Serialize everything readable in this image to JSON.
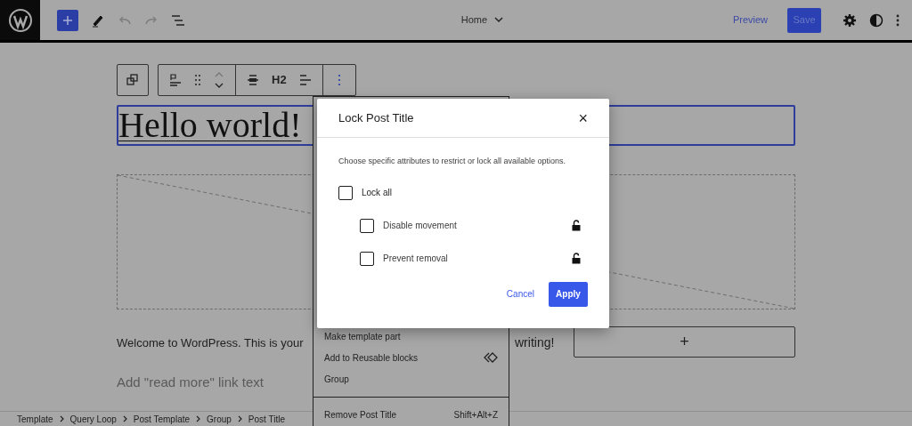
{
  "top_bar": {
    "document_title": "Home",
    "preview": "Preview",
    "save": "Save"
  },
  "block_toolbar": {
    "heading_level": "H2"
  },
  "canvas": {
    "post_title": "Hello world!",
    "excerpt_parts": [
      "Welcome to WordPress. This is your",
      "writing!"
    ],
    "read_more_placeholder": "Add \"read more\" link text",
    "appender": "+"
  },
  "block_menu": {
    "sections": [
      [
        {
          "label": "Make template part",
          "kind": "plain"
        },
        {
          "label": "Add to Reusable blocks",
          "kind": "reusable"
        },
        {
          "label": "Group",
          "kind": "plain"
        }
      ],
      [
        {
          "label": "Remove Post Title",
          "kind": "shortcut",
          "shortcut": "Shift+Alt+Z"
        }
      ]
    ]
  },
  "breadcrumbs": [
    "Template",
    "Query Loop",
    "Post Template",
    "Group",
    "Post Title"
  ],
  "dialog": {
    "title": "Lock Post Title",
    "close": "×",
    "description": "Choose specific attributes to restrict or lock all available options.",
    "lock_all": {
      "label": "Lock all",
      "checked": false
    },
    "options": [
      {
        "label": "Disable movement",
        "checked": false
      },
      {
        "label": "Prevent removal",
        "checked": false
      }
    ],
    "cancel": "Cancel",
    "apply": "Apply"
  }
}
